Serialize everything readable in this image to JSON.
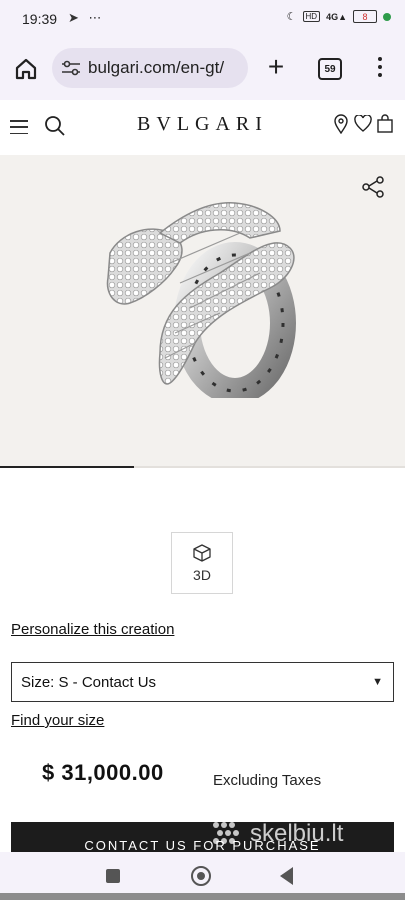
{
  "status_bar": {
    "time": "19:39",
    "left_icons": [
      "telegram-icon",
      "more-dots-icon"
    ],
    "right_icons": [
      "moon-icon",
      "volte-icon",
      "4g-signal-icon",
      "battery-icon",
      "charging-dot-icon"
    ],
    "battery_level": "8",
    "network": "4G"
  },
  "browser": {
    "url": "bulgari.com/en-gt/",
    "tab_count": "59",
    "icons": [
      "home-icon",
      "site-settings-icon",
      "new-tab-plus-icon",
      "tab-switcher-icon",
      "overflow-menu-icon"
    ]
  },
  "site_header": {
    "brand": "BVLGARI",
    "icons": [
      "hamburger-menu-icon",
      "search-icon",
      "store-locator-icon",
      "wishlist-heart-icon",
      "shopping-bag-icon"
    ]
  },
  "product": {
    "image_alt": "Serpenti ring in white gold with diamonds",
    "share_icon": "share-icon",
    "gallery_progress": 0.33,
    "btn_3d_label": "3D",
    "personalize_label": "Personalize this creation",
    "size_select_value": "Size: S - Contact Us",
    "find_size_label": "Find your size",
    "price": "$ 31,000.00",
    "price_note": "Excluding Taxes",
    "cta_label": "CONTACT US FOR PURCHASE"
  },
  "watermark": {
    "text": "skelbiu.lt"
  },
  "nav_bar": {
    "icons": [
      "recents-square-icon",
      "home-circle-icon",
      "back-triangle-icon"
    ]
  },
  "colors": {
    "status_bg": "#f5f2fa",
    "url_pill_bg": "#e6e1ef",
    "product_bg": "#f3f1ee",
    "cta_bg": "#1c1c1c",
    "battery_accent": "#d0312d",
    "charging_green": "#2e9b4a"
  }
}
